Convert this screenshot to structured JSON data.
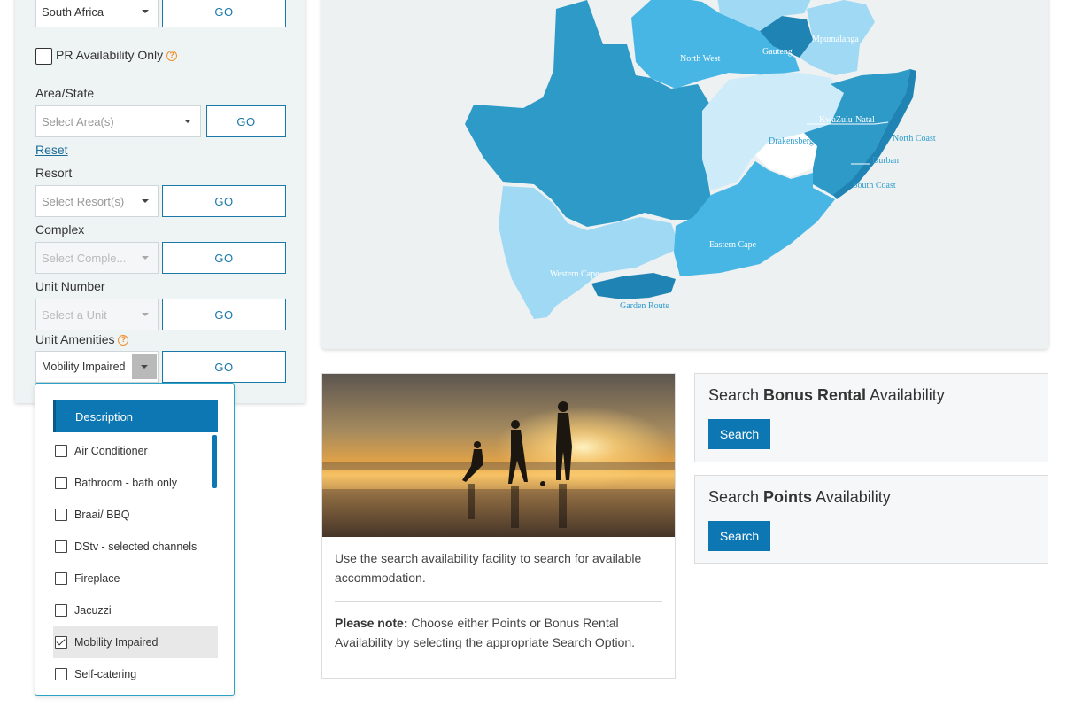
{
  "filters": {
    "country": {
      "value": "South Africa",
      "go": "GO"
    },
    "pr_only": {
      "label": "PR Availability Only",
      "help": "?"
    },
    "area": {
      "label": "Area/State",
      "placeholder": "Select Area(s)",
      "go": "GO"
    },
    "reset": "Reset",
    "resort": {
      "label": "Resort",
      "placeholder": "Select Resort(s)",
      "go": "GO"
    },
    "complex": {
      "label": "Complex",
      "placeholder": "Select Comple...",
      "go": "GO"
    },
    "unit_number": {
      "label": "Unit Number",
      "placeholder": "Select a Unit",
      "go": "GO"
    },
    "amenities": {
      "label": "Unit Amenities",
      "help": "?",
      "value": "Mobility Impaired",
      "go": "GO"
    }
  },
  "amenities_dropdown": {
    "header": "Description",
    "items": [
      {
        "label": "Air Conditioner",
        "checked": false
      },
      {
        "label": "Bathroom - bath only",
        "checked": false
      },
      {
        "label": "Braai/ BBQ",
        "checked": false
      },
      {
        "label": "DStv - selected channels",
        "checked": false
      },
      {
        "label": "Fireplace",
        "checked": false
      },
      {
        "label": "Jacuzzi",
        "checked": false
      },
      {
        "label": "Mobility Impaired",
        "checked": true
      },
      {
        "label": "Self-catering",
        "checked": false
      }
    ]
  },
  "map": {
    "regions": {
      "north_west": "North West",
      "gauteng": "Gauteng",
      "mpumalanga": "Mpumalanga",
      "kwazulu_natal": "KwaZulu-Natal",
      "north_coast": "North Coast",
      "drakensberg": "Drakensberg",
      "durban": "Durban",
      "south_coast": "South Coast",
      "eastern_cape": "Eastern Cape",
      "western_cape": "Western Cape",
      "garden_route": "Garden Route"
    },
    "colors": {
      "dark": "#2e9ac8",
      "mid": "#48b6e4",
      "light": "#9fd9f3",
      "pale": "#cdebf8",
      "navy": "#1f84b4"
    }
  },
  "info": {
    "text": "Use the search availability facility to search for available accommodation.",
    "note_label": "Please note:",
    "note_text": " Choose either Points or Bonus Rental Availability by selecting the appropriate Search Option."
  },
  "search_bonus": {
    "prefix": "Search ",
    "bold": "Bonus Rental",
    "suffix": " Availability",
    "button": "Search"
  },
  "search_points": {
    "prefix": "Search ",
    "bold": "Points",
    "suffix": " Availability",
    "button": "Search"
  }
}
